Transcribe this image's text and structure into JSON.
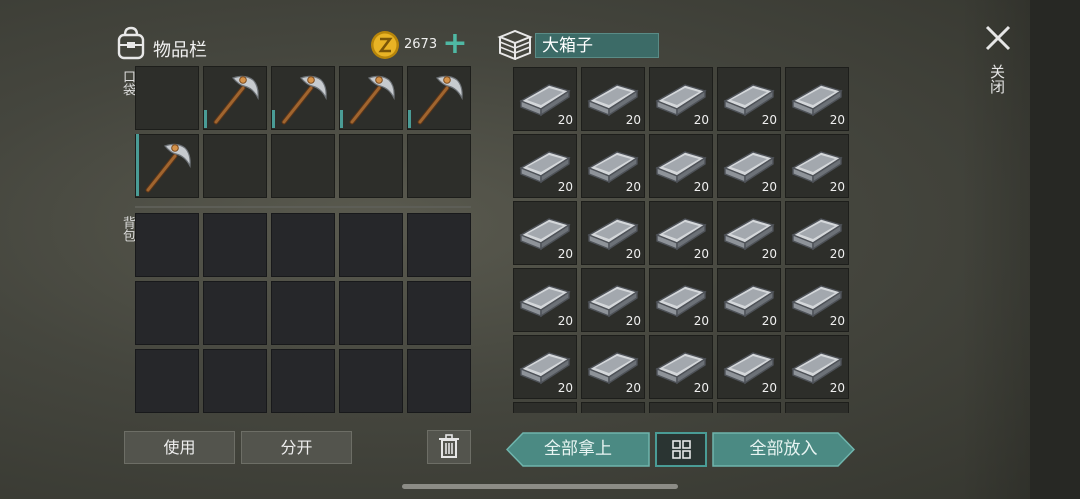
{
  "inventory": {
    "title": "物品栏",
    "coins": "2673",
    "pocket_label": "口袋",
    "backpack_label": "背包",
    "pocket_slots": [
      {
        "item": "",
        "icon": ""
      },
      {
        "item": "pickaxe",
        "icon": "pickaxe-icon"
      },
      {
        "item": "pickaxe",
        "icon": "pickaxe-icon"
      },
      {
        "item": "pickaxe",
        "icon": "pickaxe-icon"
      },
      {
        "item": "pickaxe",
        "icon": "pickaxe-icon"
      },
      {
        "item": "pickaxe",
        "icon": "pickaxe-icon"
      },
      {
        "item": "",
        "icon": ""
      },
      {
        "item": "",
        "icon": ""
      },
      {
        "item": "",
        "icon": ""
      },
      {
        "item": "",
        "icon": ""
      }
    ],
    "backpack_slot_count": 15
  },
  "chest": {
    "name": "大箱子",
    "slot_quantity": "20",
    "visible_full_rows": 5,
    "columns": 5
  },
  "close": {
    "label": "关闭"
  },
  "buttons": {
    "use": "使用",
    "split": "分开",
    "take_all": "全部拿上",
    "put_all": "全部放入"
  },
  "colors": {
    "accent": "#4a9c96",
    "chest_name_bg": "#3c6b67",
    "plus": "#4fb8a4",
    "coin": "#d9a520"
  }
}
